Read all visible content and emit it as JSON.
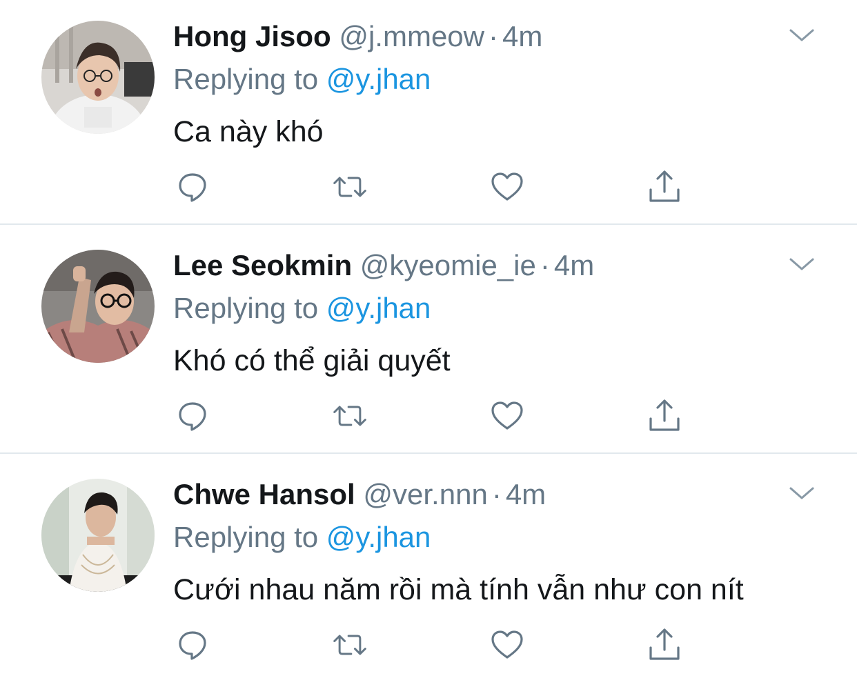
{
  "colors": {
    "name": "#14171a",
    "muted": "#657786",
    "link": "#1b95e0",
    "icon": "#657786",
    "divider": "#e1e8ed"
  },
  "tweets": [
    {
      "name": "Hong Jisoo",
      "handle": "@j.mmeow",
      "separator": "·",
      "time": "4m",
      "replying_prefix": "Replying to",
      "replying_to": "@y.jhan",
      "text": "Ca này khó",
      "avatar_icon": "avatar-photo",
      "actions": [
        "reply-icon",
        "retweet-icon",
        "like-icon",
        "share-icon"
      ]
    },
    {
      "name": "Lee Seokmin",
      "handle": "@kyeomie_ie",
      "separator": "·",
      "time": "4m",
      "replying_prefix": "Replying to",
      "replying_to": "@y.jhan",
      "text": "Khó có thể giải quyết",
      "avatar_icon": "avatar-photo",
      "actions": [
        "reply-icon",
        "retweet-icon",
        "like-icon",
        "share-icon"
      ]
    },
    {
      "name": "Chwe Hansol",
      "handle": "@ver.nnn",
      "separator": "·",
      "time": "4m",
      "replying_prefix": "Replying to",
      "replying_to": "@y.jhan",
      "text": "Cưới nhau năm rồi mà tính vẫn như con nít",
      "avatar_icon": "avatar-photo",
      "actions": [
        "reply-icon",
        "retweet-icon",
        "like-icon",
        "share-icon"
      ]
    }
  ]
}
